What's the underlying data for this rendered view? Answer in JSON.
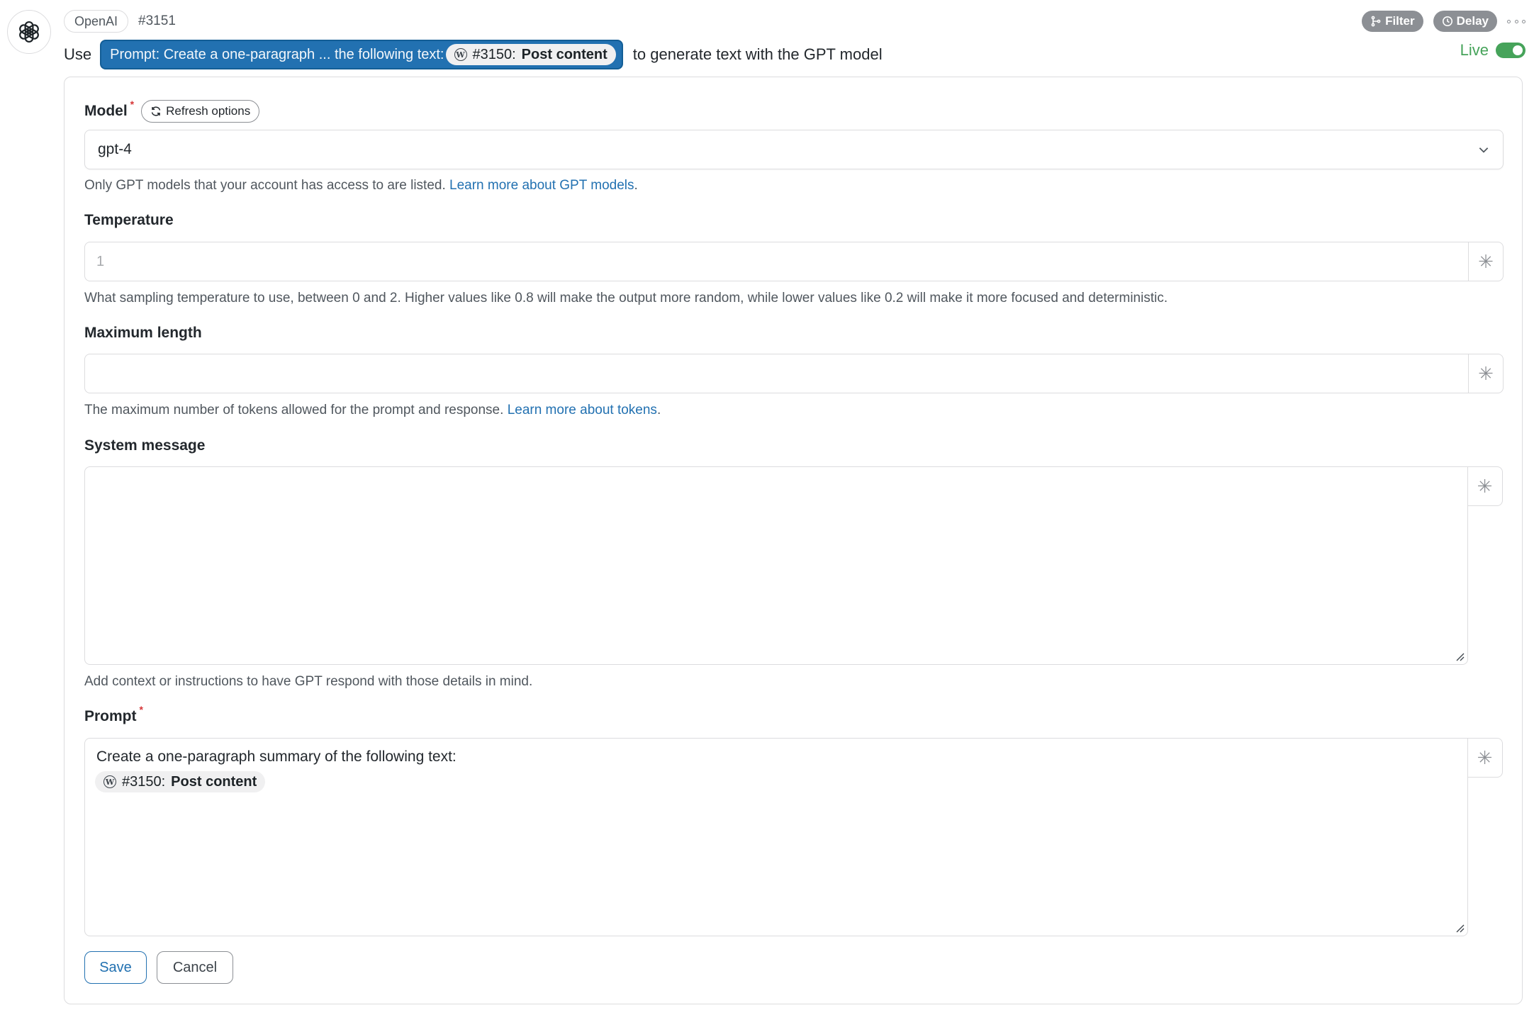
{
  "header": {
    "app_name": "OpenAI",
    "step_id": "#3151",
    "filter_label": "Filter",
    "delay_label": "Delay",
    "live_label": "Live",
    "live_on": true
  },
  "sentence": {
    "prefix": "Use",
    "prompt_token_label": "Prompt: Create a one-paragraph ... the following text:",
    "inner_token_id": "#3150:",
    "inner_token_name": "Post content",
    "suffix": "to generate text with the GPT model"
  },
  "form": {
    "model": {
      "label": "Model",
      "refresh_label": "Refresh options",
      "value": "gpt-4",
      "help": "Only GPT models that your account has access to are listed.",
      "help_link": "Learn more about GPT models",
      "help_end": "."
    },
    "temperature": {
      "label": "Temperature",
      "placeholder": "1",
      "help": "What sampling temperature to use, between 0 and 2. Higher values like 0.8 will make the output more random, while lower values like 0.2 will make it more focused and deterministic."
    },
    "max_length": {
      "label": "Maximum length",
      "value": "",
      "help": "The maximum number of tokens allowed for the prompt and response.",
      "help_link": "Learn more about tokens",
      "help_end": "."
    },
    "system_message": {
      "label": "System message",
      "value": "",
      "help": "Add context or instructions to have GPT respond with those details in mind."
    },
    "prompt": {
      "label": "Prompt",
      "text": "Create a one-paragraph summary of the following text:",
      "token_id": "#3150:",
      "token_name": "Post content"
    },
    "star_glyph": "✳",
    "save_label": "Save",
    "cancel_label": "Cancel"
  },
  "colors": {
    "accent": "#2271b1",
    "live": "#46a35a",
    "required": "#d63638"
  },
  "icons": [
    "openai-logo-icon",
    "filter-icon",
    "clock-icon",
    "more-icon",
    "wordpress-icon",
    "refresh-icon",
    "chevron-down-icon",
    "asterisk-icon",
    "resize-grip-icon"
  ]
}
